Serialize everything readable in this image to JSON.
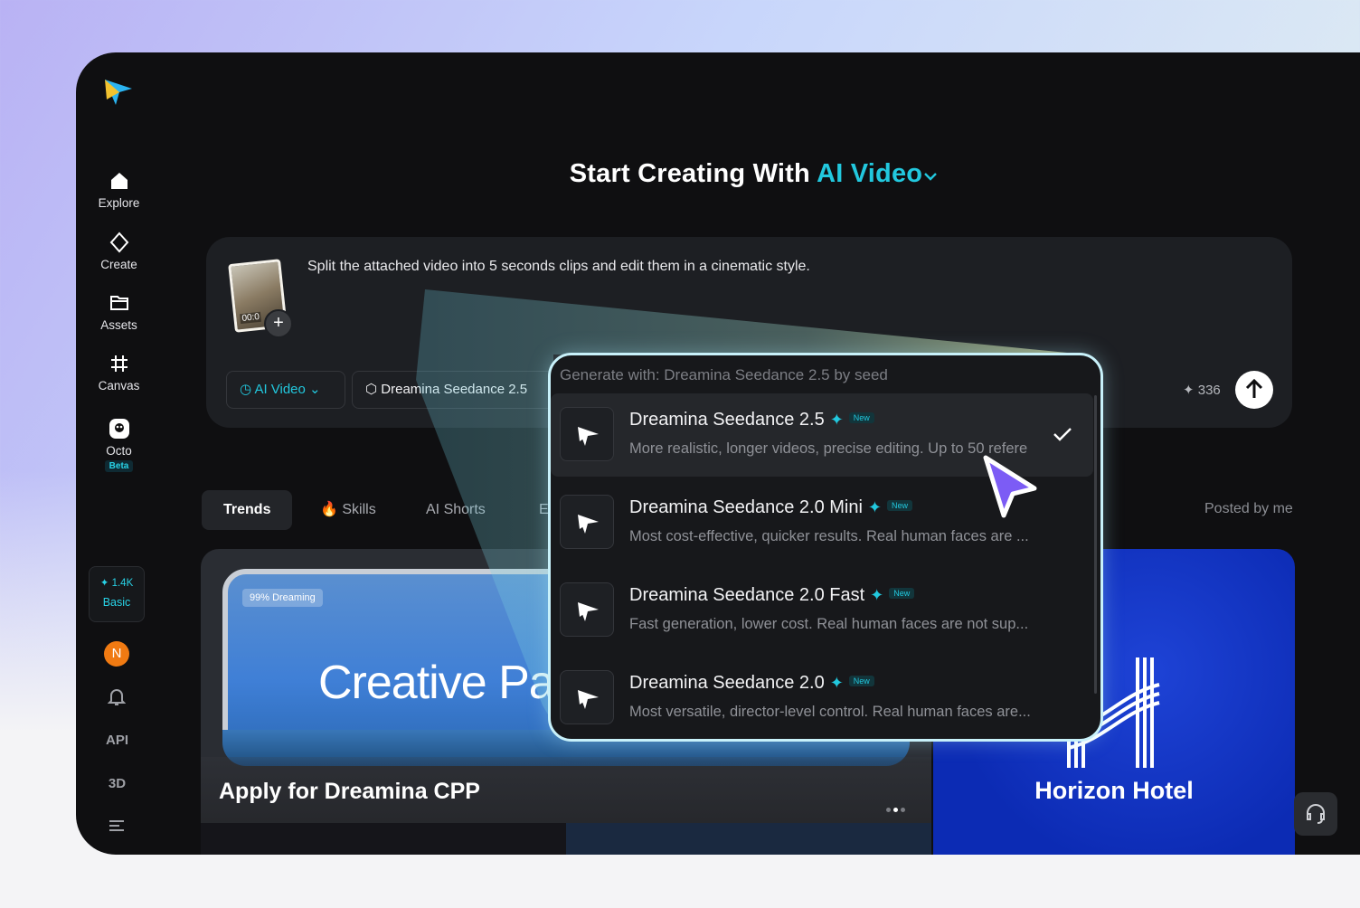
{
  "sidebar": {
    "items": [
      {
        "label": "Explore",
        "icon": "home-icon"
      },
      {
        "label": "Create",
        "icon": "diamond-sparkle-icon"
      },
      {
        "label": "Assets",
        "icon": "folder-icon"
      },
      {
        "label": "Canvas",
        "icon": "frame-icon"
      },
      {
        "label": "Octo",
        "icon": "octo-icon",
        "badge": "Beta"
      }
    ],
    "credits": {
      "amount": "1.4K",
      "plan": "Basic"
    },
    "avatar_initial": "N",
    "api_label": "API",
    "three_d_label": "3D"
  },
  "header": {
    "title_prefix": "Start Creating With",
    "title_accent": "AI Video"
  },
  "prompt": {
    "text": "Split the attached video into 5 seconds clips and edit them in a cinematic style.",
    "thumb_time": "00:0",
    "mode_label": "AI Video",
    "model_label": "Dreamina Seedance 2.5",
    "credit_count": "336"
  },
  "tabs": [
    {
      "label": "Trends",
      "active": true
    },
    {
      "label": "Skills"
    },
    {
      "label": "AI Shorts"
    },
    {
      "label": "E"
    }
  ],
  "posted_label": "Posted by me",
  "banner_left": {
    "badge": "99% Dreaming",
    "headline": "Creative Pa",
    "caption": "Apply for Dreamina CPP"
  },
  "banner_right": {
    "caption": "Horizon Hotel"
  },
  "dropdown": {
    "header": "Generate with: Dreamina Seedance 2.5 by seed",
    "badge_new": "New",
    "models": [
      {
        "name": "Dreamina Seedance 2.5",
        "desc": "More realistic, longer videos, precise editing. Up to 50 refere",
        "selected": true
      },
      {
        "name": "Dreamina Seedance 2.0 Mini",
        "desc": "Most cost-effective, quicker results. Real human faces are ..."
      },
      {
        "name": "Dreamina Seedance 2.0 Fast",
        "desc": "Fast generation, lower cost. Real human faces are not sup..."
      },
      {
        "name": "Dreamina Seedance 2.0",
        "desc": "Most versatile, director-level control. Real human faces are..."
      }
    ]
  },
  "colors": {
    "accent": "#22c8de",
    "cursor": "#7c5cf5",
    "popup_border": "#c8f1fa"
  }
}
